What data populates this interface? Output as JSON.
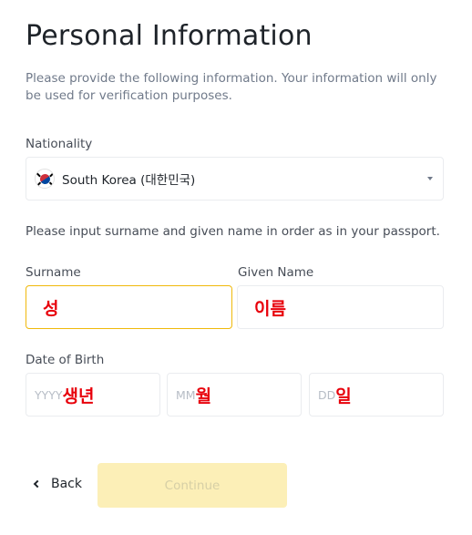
{
  "page": {
    "title": "Personal Information",
    "intro": "Please provide the following information. Your information will only be used for verification purposes."
  },
  "nationality": {
    "label": "Nationality",
    "flag_icon": "south-korea-flag-icon",
    "value": "South Korea (대한민국)"
  },
  "name_hint": "Please input surname and given name in order as in your passport.",
  "surname": {
    "label": "Surname",
    "annotation": "성"
  },
  "given_name": {
    "label": "Given Name",
    "annotation": "이름"
  },
  "dob": {
    "label": "Date of Birth",
    "year": {
      "placeholder": "YYYY",
      "annotation": "생년"
    },
    "month": {
      "placeholder": "MM",
      "annotation": "월"
    },
    "day": {
      "placeholder": "DD",
      "annotation": "일"
    }
  },
  "actions": {
    "back_label": "Back",
    "continue_label": "Continue"
  },
  "colors": {
    "accent": "#f0b90b",
    "annotation": "#e8000b",
    "continue_disabled_bg": "#fcefb7"
  }
}
